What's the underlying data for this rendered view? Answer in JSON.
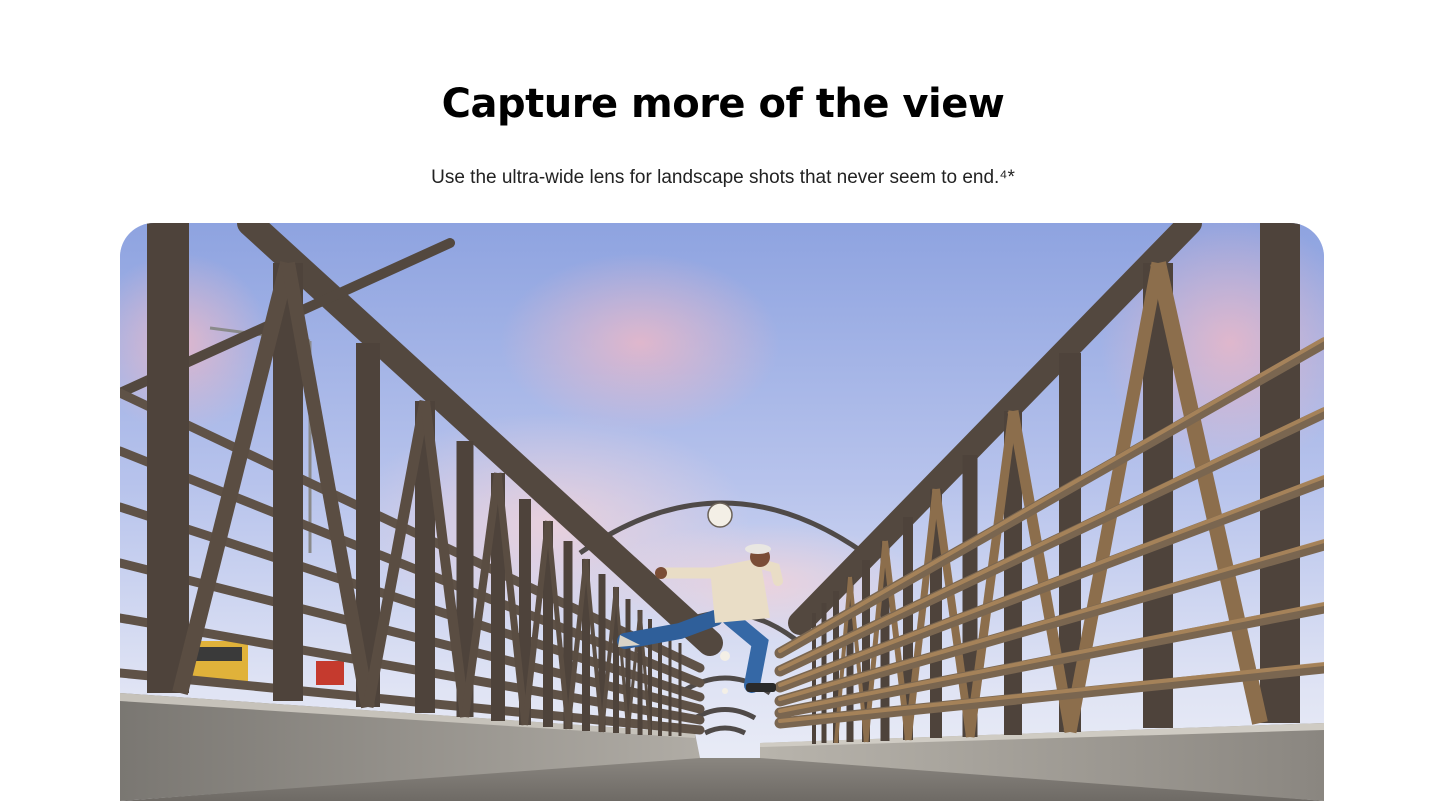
{
  "section": {
    "headline": "Capture more of the view",
    "subtext": "Use the ultra-wide lens for landscape shots that never seem to end.⁴*"
  },
  "photo": {
    "subject": "ultra-wide photo of a person leaping on a steel footbridge under a pastel sky"
  },
  "colors": {
    "headline": "#000000",
    "subtext": "#222222",
    "sky_top": "#8ea3e0",
    "sky_pink": "#e4b6c8",
    "steel": "#5a4c40",
    "railing_rust": "#b08a5c",
    "concrete": "#9a9690"
  }
}
